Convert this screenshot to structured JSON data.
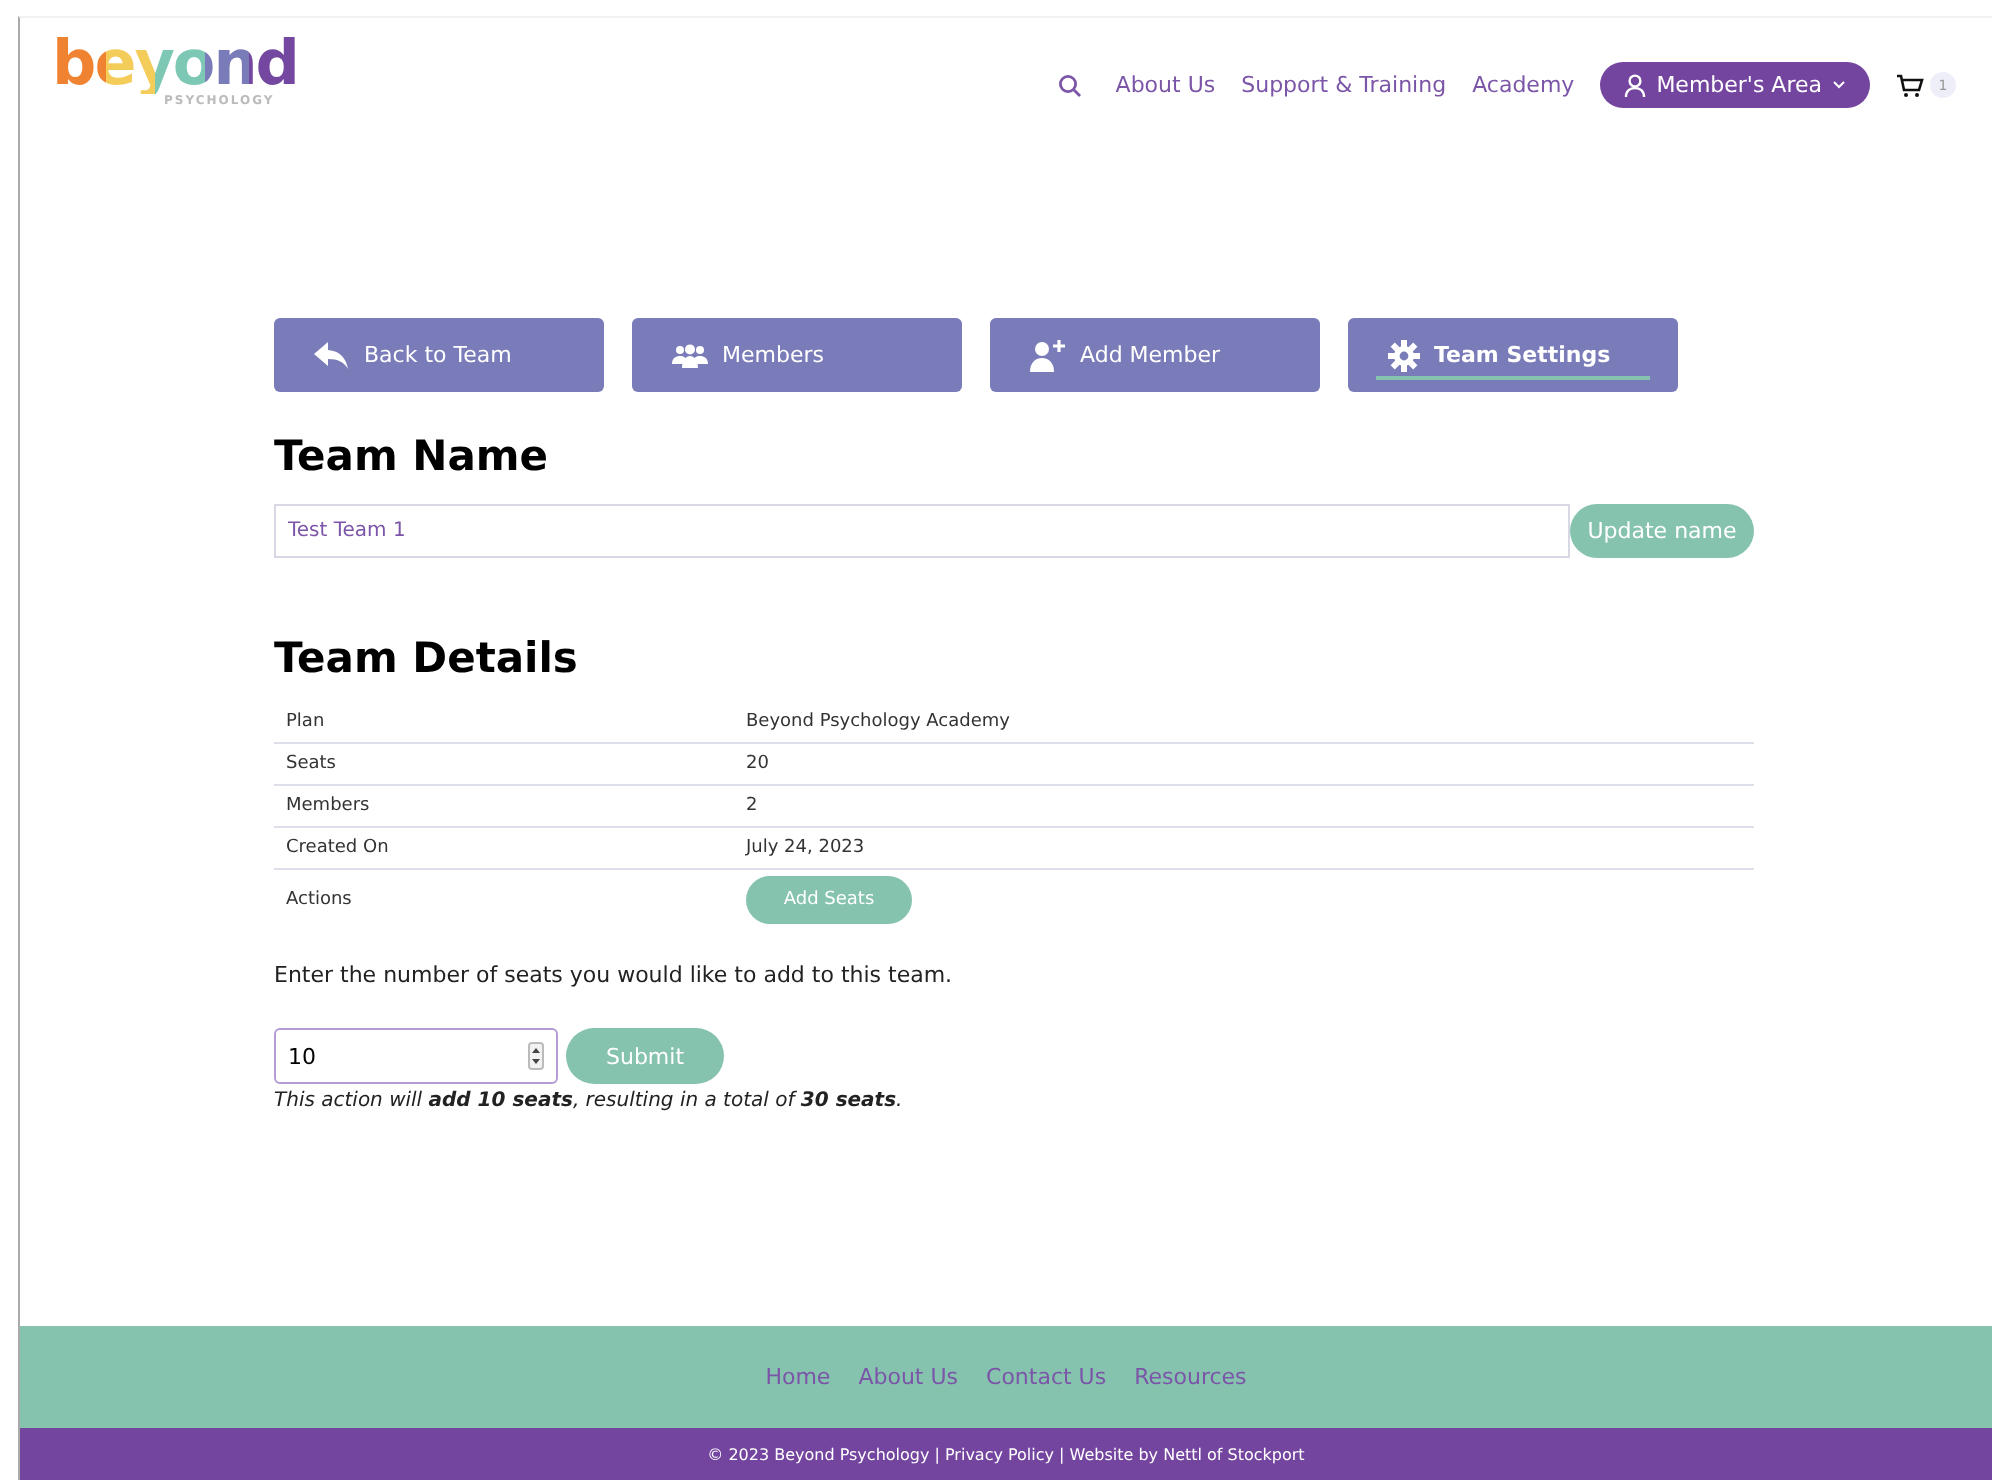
{
  "header": {
    "logo": "beyond",
    "logo_sub": "PSYCHOLOGY",
    "nav": [
      "About Us",
      "Support & Training",
      "Academy"
    ],
    "member_button": "Member's Area",
    "cart_count": "1"
  },
  "tabs": [
    {
      "label": "Back to Team",
      "kind": "back",
      "selected": false
    },
    {
      "label": "Members",
      "kind": "members",
      "selected": false
    },
    {
      "label": "Add Member",
      "kind": "add",
      "selected": false
    },
    {
      "label": "Team Settings",
      "kind": "settings",
      "selected": true
    }
  ],
  "team_name": {
    "heading": "Team Name",
    "value": "Test Team 1",
    "button": "Update name"
  },
  "team_details": {
    "heading": "Team Details",
    "rows": [
      {
        "label": "Plan",
        "value": "Beyond Psychology Academy"
      },
      {
        "label": "Seats",
        "value": "20"
      },
      {
        "label": "Members",
        "value": "2"
      },
      {
        "label": "Created On",
        "value": "July 24, 2023"
      },
      {
        "label": "Actions",
        "button": "Add Seats"
      }
    ]
  },
  "add_seats": {
    "prompt": "Enter the number of seats you would like to add to this team.",
    "value": "10",
    "button": "Submit",
    "note": "This action will **add 10 seats**, resulting in a total of **30 seats**."
  },
  "footer": {
    "links": [
      "Home",
      "About Us",
      "Contact Us",
      "Resources"
    ],
    "copyright": "© 2023 Beyond Psychology | Privacy Policy | Website by Nettl of Stockport"
  }
}
